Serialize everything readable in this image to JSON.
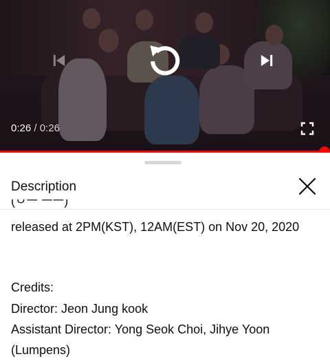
{
  "player": {
    "current_time": "0:26",
    "separator": " / ",
    "duration": "0:26",
    "progress": 1.0,
    "icons": {
      "previous": "skip-previous-icon",
      "replay": "replay-icon",
      "next": "skip-next-icon",
      "fullscreen": "fullscreen-icon"
    }
  },
  "description_panel": {
    "title": "Description",
    "close_icon": "close-icon",
    "lines": [
      "(ㅇㅡ ㅡㅡ)",
      "released at 2PM(KST), 12AM(EST) on Nov 20, 2020",
      "",
      "Credits:",
      "Director: Jeon Jung kook",
      "Assistant Director: Yong Seok Choi, Jihye Yoon",
      "(Lumpens)"
    ]
  },
  "colors": {
    "accent": "#ff0000",
    "text": "#0f0f0f",
    "sheet_bg": "#ffffff"
  }
}
